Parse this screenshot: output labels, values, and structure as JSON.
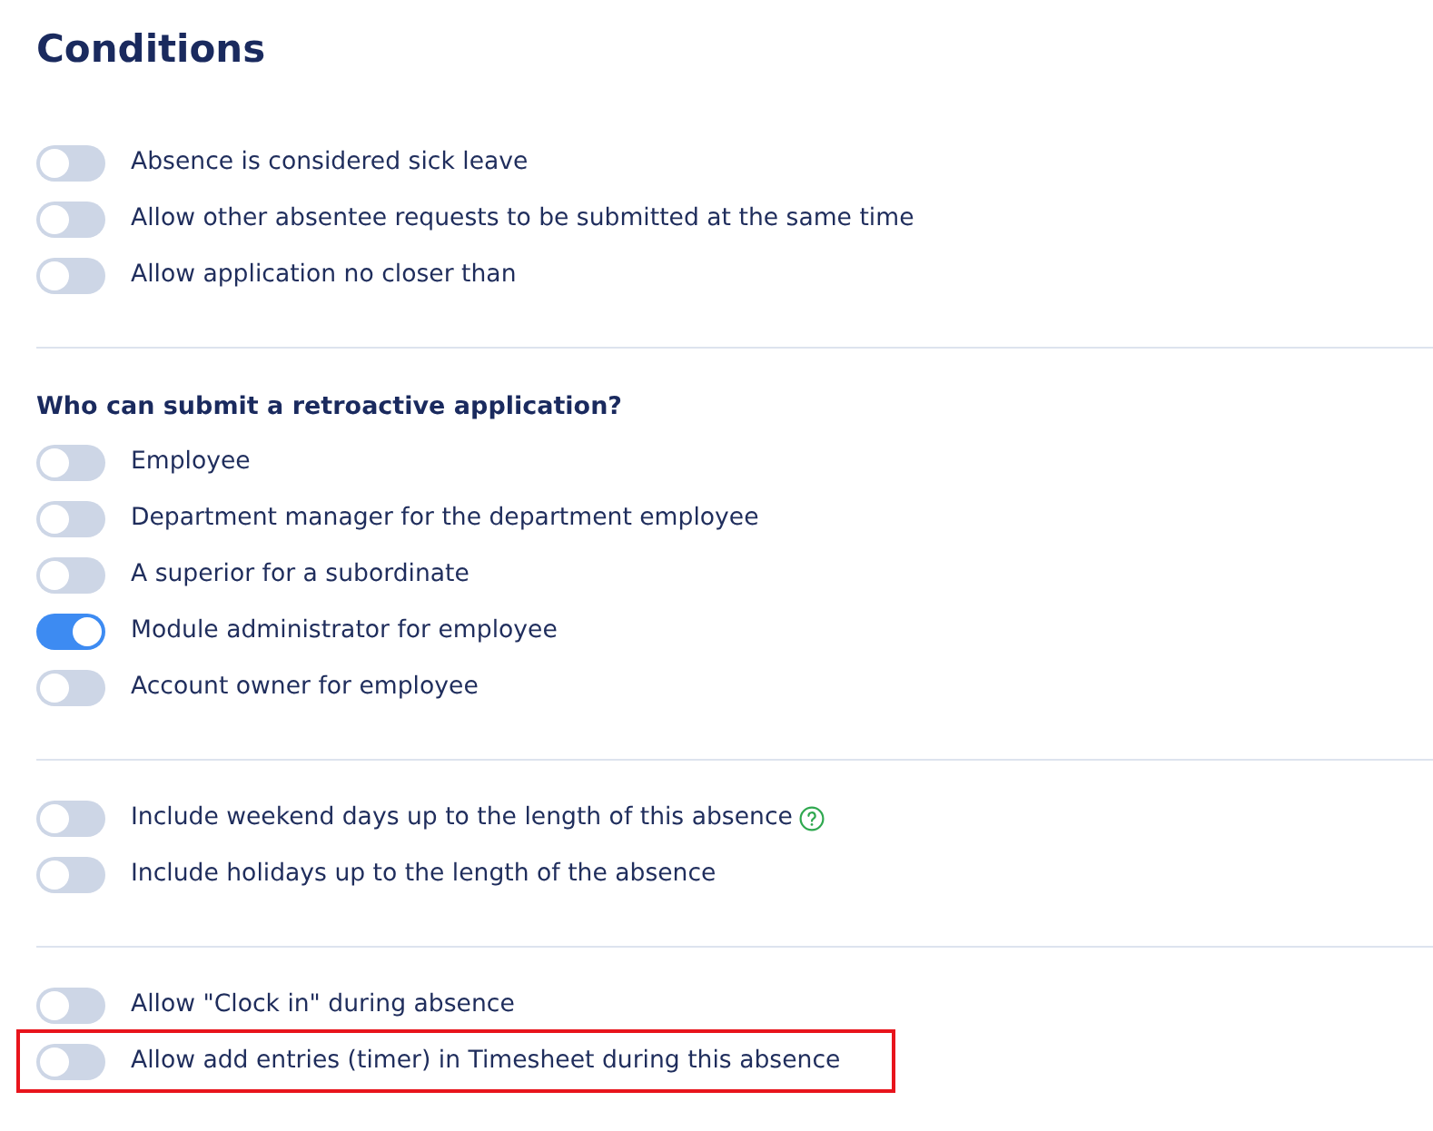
{
  "title": "Conditions",
  "sections": [
    {
      "items": [
        {
          "label": "Absence is considered sick leave",
          "on": false
        },
        {
          "label": "Allow other absentee requests to be submitted at the same time",
          "on": false
        },
        {
          "label": "Allow application no closer than",
          "on": false
        }
      ]
    },
    {
      "heading": "Who can submit a retroactive application?",
      "items": [
        {
          "label": "Employee",
          "on": false
        },
        {
          "label": "Department manager for the department employee",
          "on": false
        },
        {
          "label": "A superior for a subordinate",
          "on": false
        },
        {
          "label": "Module administrator for employee",
          "on": true
        },
        {
          "label": "Account owner for employee",
          "on": false
        }
      ]
    },
    {
      "items": [
        {
          "label": "Include weekend days up to the length of this absence",
          "on": false,
          "help": true
        },
        {
          "label": "Include holidays up to the length of the absence",
          "on": false
        }
      ]
    },
    {
      "items": [
        {
          "label": "Allow \"Clock in\" during absence",
          "on": false
        },
        {
          "label": "Allow add entries (timer) in Timesheet during this absence",
          "on": false,
          "highlighted": true
        }
      ]
    }
  ]
}
